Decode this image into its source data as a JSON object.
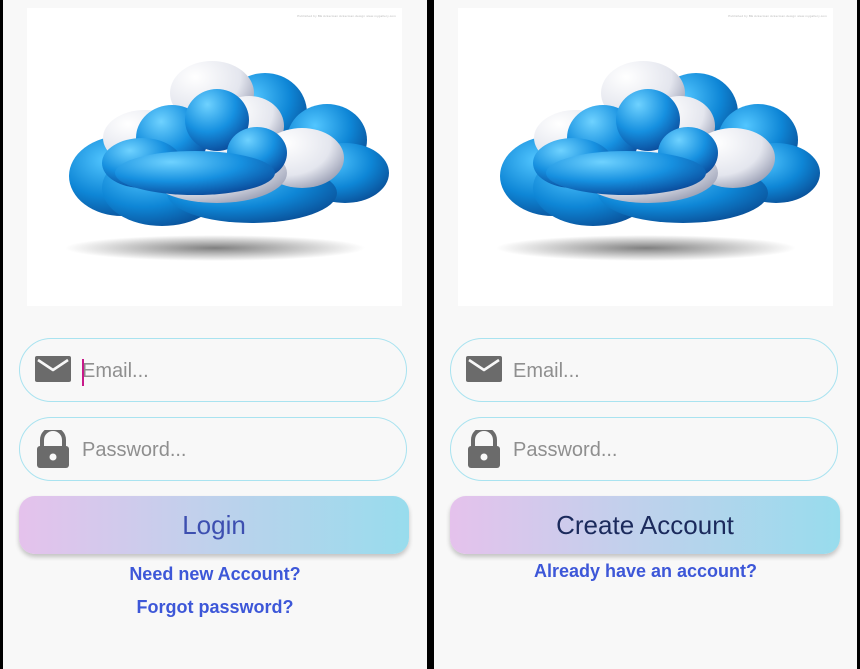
{
  "login_screen": {
    "watermark": "Published by BE Ackerman    Ackerman.design    www.mygallery.com",
    "email": {
      "placeholder": "Email...",
      "value": ""
    },
    "password": {
      "placeholder": "Password...",
      "value": ""
    },
    "submit_label": "Login",
    "links": [
      "Need new Account?",
      "Forgot password?"
    ]
  },
  "signup_screen": {
    "watermark": "Published by BE Ackerman    Ackerman.design    www.mygallery.com",
    "email": {
      "placeholder": "Email...",
      "value": ""
    },
    "password": {
      "placeholder": "Password...",
      "value": ""
    },
    "submit_label": "Create Account",
    "links": [
      "Already have an account?"
    ]
  },
  "icons": {
    "email": "envelope-icon",
    "password": "lock-icon",
    "hero": "cloud-illustration"
  },
  "colors": {
    "field_border": "#a9e3f0",
    "button_gradient": [
      "#e5c2ec",
      "#98dced"
    ],
    "login_text": "#3d4fb0",
    "create_text": "#1b2a5c",
    "link_text": "#3d57d8",
    "icon_gray": "#6b6b6b",
    "caret": "#c81a8a"
  }
}
